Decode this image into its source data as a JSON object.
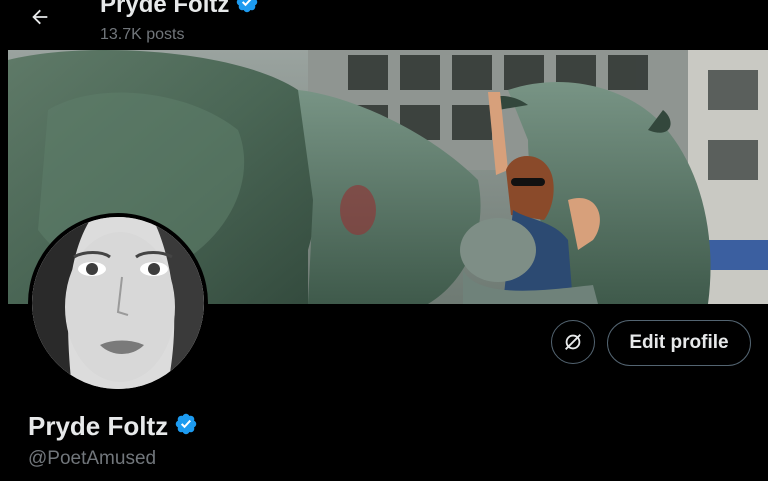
{
  "header": {
    "back_icon": "arrow-left-icon",
    "name": "Pryde Foltz",
    "posts_count": "13.7K posts",
    "verified_icon": "verified-badge-icon"
  },
  "banner": {
    "description": "Bronze bull statues with a woman in sunglasses posing"
  },
  "profile": {
    "display_name": "Pryde Foltz",
    "handle": "@PoetAmused",
    "verified_icon": "verified-badge-icon",
    "avatar_icon": "avatar-portrait"
  },
  "actions": {
    "circle_button_icon": "no-sync-icon",
    "edit_profile_label": "Edit profile"
  },
  "colors": {
    "background": "#000000",
    "text_primary": "#e7e9ea",
    "text_secondary": "#71767b",
    "verified": "#1d9bf0",
    "button_border": "#536471"
  }
}
